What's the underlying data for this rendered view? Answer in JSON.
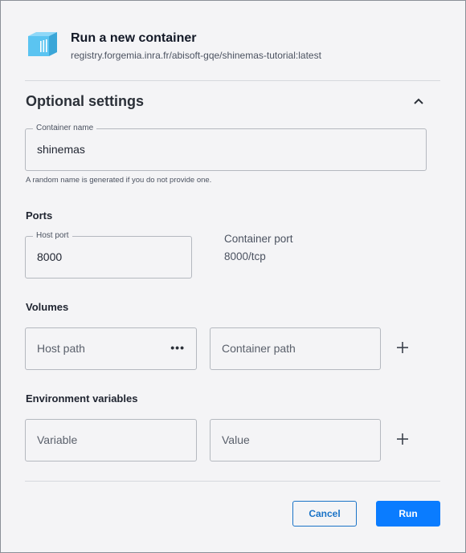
{
  "header": {
    "title": "Run a new container",
    "subtitle": "registry.forgemia.inra.fr/abisoft-gqe/shinemas-tutorial:latest",
    "logo_icon": "container-image-icon",
    "accent_color": "#5bc4f1"
  },
  "optional_settings": {
    "title": "Optional settings",
    "collapse_icon": "chevron-up-icon"
  },
  "container_name": {
    "label": "Container name",
    "value": "shinemas",
    "helper": "A random name is generated if you do not provide one."
  },
  "ports": {
    "title": "Ports",
    "host_port_label": "Host port",
    "host_port_value": "8000",
    "container_port_label": "Container port",
    "container_port_value": "8000/tcp"
  },
  "volumes": {
    "title": "Volumes",
    "host_path_placeholder": "Host path",
    "browse_icon": "ellipsis-icon",
    "container_path_placeholder": "Container path",
    "add_icon": "plus-icon"
  },
  "environment": {
    "title": "Environment variables",
    "variable_placeholder": "Variable",
    "value_placeholder": "Value",
    "add_icon": "plus-icon"
  },
  "footer": {
    "cancel_label": "Cancel",
    "run_label": "Run",
    "primary_color": "#0a7cff"
  }
}
